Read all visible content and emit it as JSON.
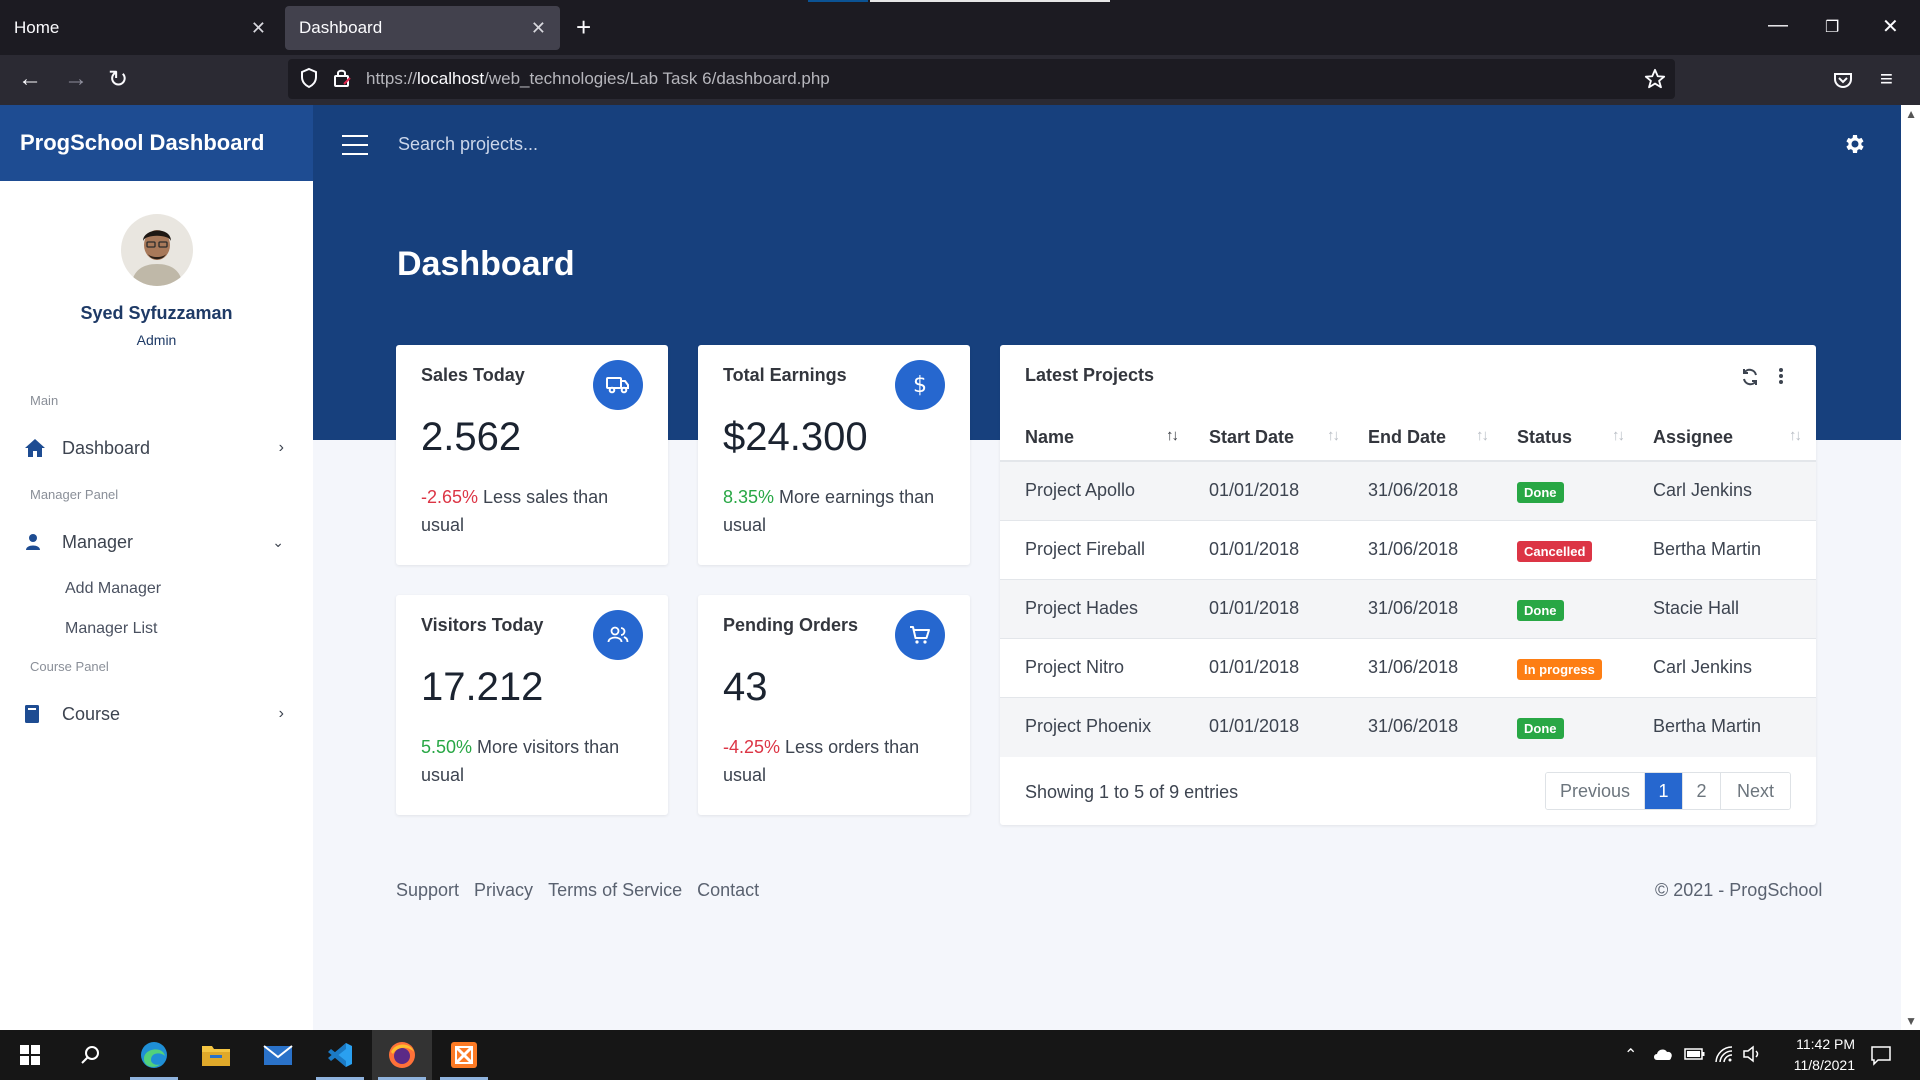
{
  "browser": {
    "tabs": [
      {
        "label": "Home"
      },
      {
        "label": "Dashboard"
      }
    ],
    "url_prefix": "https://",
    "url_host": "localhost",
    "url_path": "/web_technologies/Lab Task 6/dashboard.php"
  },
  "app": {
    "brand": "ProgSchool Dashboard",
    "search_placeholder": "Search projects...",
    "page_title": "Dashboard"
  },
  "sidebar": {
    "user_name": "Syed Syfuzzaman",
    "user_role": "Admin",
    "sections": {
      "main": "Main",
      "manager_panel": "Manager Panel",
      "course_panel": "Course Panel"
    },
    "items": {
      "dashboard": "Dashboard",
      "manager": "Manager",
      "add_manager": "Add Manager",
      "manager_list": "Manager List",
      "course": "Course"
    }
  },
  "stats": [
    {
      "title": "Sales Today",
      "value": "2.562",
      "change": "-2.65%",
      "change_text": " Less sales than usual",
      "trend": "down",
      "icon": "truck-icon"
    },
    {
      "title": "Total Earnings",
      "value": "$24.300",
      "change": "8.35%",
      "change_text": " More earnings than usual",
      "trend": "up",
      "icon": "dollar-icon"
    },
    {
      "title": "Visitors Today",
      "value": "17.212",
      "change": "5.50%",
      "change_text": " More visitors than usual",
      "trend": "up",
      "icon": "users-icon"
    },
    {
      "title": "Pending Orders",
      "value": "43",
      "change": "-4.25%",
      "change_text": " Less orders than usual",
      "trend": "down",
      "icon": "cart-icon"
    }
  ],
  "projects": {
    "title": "Latest Projects",
    "columns": [
      "Name",
      "Start Date",
      "End Date",
      "Status",
      "Assignee"
    ],
    "rows": [
      {
        "name": "Project Apollo",
        "start": "01/01/2018",
        "end": "31/06/2018",
        "status": "Done",
        "assignee": "Carl Jenkins"
      },
      {
        "name": "Project Fireball",
        "start": "01/01/2018",
        "end": "31/06/2018",
        "status": "Cancelled",
        "assignee": "Bertha Martin"
      },
      {
        "name": "Project Hades",
        "start": "01/01/2018",
        "end": "31/06/2018",
        "status": "Done",
        "assignee": "Stacie Hall"
      },
      {
        "name": "Project Nitro",
        "start": "01/01/2018",
        "end": "31/06/2018",
        "status": "In progress",
        "assignee": "Carl Jenkins"
      },
      {
        "name": "Project Phoenix",
        "start": "01/01/2018",
        "end": "31/06/2018",
        "status": "Done",
        "assignee": "Bertha Martin"
      }
    ],
    "showing": "Showing 1 to 5 of 9 entries",
    "pagination": {
      "previous": "Previous",
      "pages": [
        "1",
        "2"
      ],
      "next": "Next",
      "current": "1"
    }
  },
  "footer": {
    "links": [
      "Support",
      "Privacy",
      "Terms of Service",
      "Contact"
    ],
    "copyright": "© 2021 - ProgSchool"
  },
  "taskbar": {
    "time": "11:42 PM",
    "date": "11/8/2021"
  },
  "colors": {
    "header": "#17407d",
    "brand": "#1e4c92",
    "accent": "#2667cf",
    "success": "#28a745",
    "danger": "#dc3545",
    "warning": "#fd7e14"
  }
}
